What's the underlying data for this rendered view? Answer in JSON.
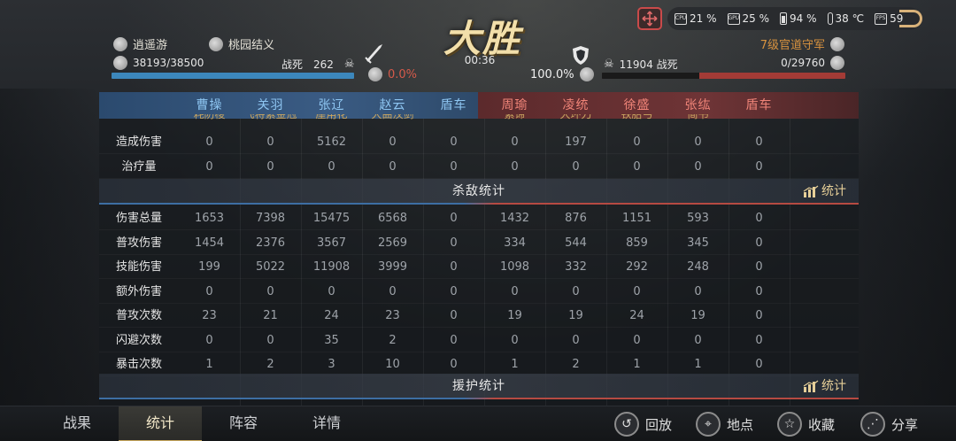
{
  "sysbar": {
    "cpu": "21 %",
    "gpu": "25 %",
    "battery": "94 %",
    "temp": "38 ℃",
    "fps": "59",
    "cpu_icon_text": "CPU",
    "gpu_icon_text": "GPU",
    "fps_icon_text": "FPS"
  },
  "header": {
    "result": "大胜",
    "timer": "00:36",
    "left": {
      "commander": "逍遥游",
      "team": "桃园结义",
      "troops": "38193/38500",
      "dead_label": "战死",
      "dead": "262",
      "pct": "0.0%",
      "bar_fill": 1.0
    },
    "right": {
      "commander": "7级官道守军",
      "troops": "0/29760",
      "dead": "11904 战死",
      "pct": "100.0%",
      "bar_fill": 0.0
    }
  },
  "table": {
    "heroes": [
      {
        "name": "曹操",
        "team": "blue",
        "cut": "耗防棱"
      },
      {
        "name": "关羽",
        "team": "blue",
        "cut": "飞将紫金冠"
      },
      {
        "name": "张辽",
        "team": "blue",
        "cut": "崖甪花"
      },
      {
        "name": "赵云",
        "team": "blue",
        "cut": "大曲汉剑"
      },
      {
        "name": "盾车",
        "team": "blue",
        "cut": ""
      },
      {
        "name": "周瑜",
        "team": "red",
        "cut": "紫谛"
      },
      {
        "name": "凌统",
        "team": "red",
        "cut": "大环刀"
      },
      {
        "name": "徐盛",
        "team": "red",
        "cut": "铁胎弓"
      },
      {
        "name": "张纮",
        "team": "red",
        "cut": "简书"
      },
      {
        "name": "盾车",
        "team": "red",
        "cut": ""
      }
    ],
    "rows_top": [
      {
        "label": "造成伤害",
        "values": [
          "0",
          "0",
          "5162",
          "0",
          "0",
          "0",
          "197",
          "0",
          "0",
          "0"
        ]
      },
      {
        "label": "治疗量",
        "values": [
          "0",
          "0",
          "0",
          "0",
          "0",
          "0",
          "0",
          "0",
          "0",
          "0"
        ]
      }
    ],
    "section_kill": {
      "title": "杀敌统计",
      "link": "统计"
    },
    "rows_kill": [
      {
        "label": "伤害总量",
        "values": [
          "1653",
          "7398",
          "15475",
          "6568",
          "0",
          "1432",
          "876",
          "1151",
          "593",
          "0"
        ]
      },
      {
        "label": "普攻伤害",
        "values": [
          "1454",
          "2376",
          "3567",
          "2569",
          "0",
          "334",
          "544",
          "859",
          "345",
          "0"
        ]
      },
      {
        "label": "技能伤害",
        "values": [
          "199",
          "5022",
          "11908",
          "3999",
          "0",
          "1098",
          "332",
          "292",
          "248",
          "0"
        ]
      },
      {
        "label": "额外伤害",
        "values": [
          "0",
          "0",
          "0",
          "0",
          "0",
          "0",
          "0",
          "0",
          "0",
          "0"
        ]
      },
      {
        "label": "普攻次数",
        "values": [
          "23",
          "21",
          "24",
          "23",
          "0",
          "19",
          "19",
          "24",
          "19",
          "0"
        ]
      },
      {
        "label": "闪避次数",
        "values": [
          "0",
          "0",
          "35",
          "2",
          "0",
          "0",
          "0",
          "0",
          "0",
          "0"
        ]
      },
      {
        "label": "暴击次数",
        "values": [
          "1",
          "2",
          "3",
          "10",
          "0",
          "1",
          "2",
          "1",
          "1",
          "0"
        ]
      }
    ],
    "section_support": {
      "title": "援护统计",
      "link": "统计"
    }
  },
  "bottom": {
    "tabs": [
      "战果",
      "统计",
      "阵容",
      "详情"
    ],
    "active_tab": "统计",
    "actions": [
      {
        "label": "回放",
        "icon": "replay-icon"
      },
      {
        "label": "地点",
        "icon": "location-icon"
      },
      {
        "label": "收藏",
        "icon": "star-icon"
      },
      {
        "label": "分享",
        "icon": "share-icon"
      }
    ]
  }
}
